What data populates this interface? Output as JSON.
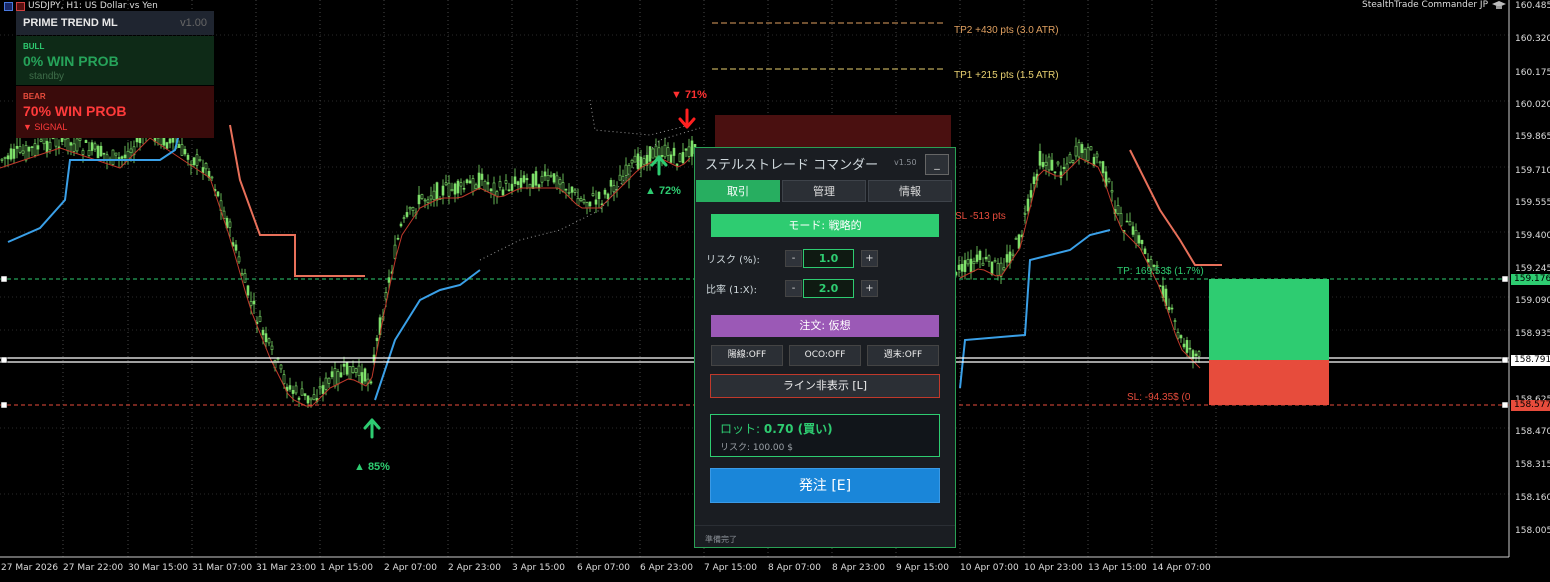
{
  "header": {
    "symbol": "USDJPY, H1:  US Dollar vs Yen",
    "ea_name": "StealthTrade Commander JP"
  },
  "prime_trend": {
    "title": "PRIME TREND  ML",
    "version": "v1.00",
    "bull_label": "BULL",
    "bull_prob": "0%  WIN PROB",
    "bull_status": "standby",
    "bear_label": "BEAR",
    "bear_prob": "70%  WIN PROB",
    "bear_status": "▼  SIGNAL"
  },
  "price_axis": {
    "labels": [
      "160.485",
      "160.320",
      "160.175",
      "160.020",
      "159.865",
      "159.710",
      "159.555",
      "159.400",
      "159.245",
      "159.090",
      "158.935",
      "158.625",
      "158.470",
      "158.315",
      "158.160",
      "158.005"
    ],
    "tags": [
      {
        "value": "159.176",
        "color": "#2ecc71"
      },
      {
        "value": "158.791",
        "color": "#ffffff"
      },
      {
        "value": "158.577",
        "color": "#e74c3c"
      }
    ]
  },
  "time_axis": [
    "27 Mar 2026",
    "27 Mar 22:00",
    "30 Mar 15:00",
    "31 Mar 07:00",
    "31 Mar 23:00",
    "1 Apr 15:00",
    "2 Apr 07:00",
    "2 Apr 23:00",
    "3 Apr 15:00",
    "6 Apr 07:00",
    "6 Apr 23:00",
    "7 Apr 15:00",
    "8 Apr 07:00",
    "8 Apr 23:00",
    "9 Apr 15:00",
    "10 Apr 07:00",
    "10 Apr 23:00",
    "13 Apr 15:00",
    "14 Apr 07:00"
  ],
  "annotations": {
    "tp2": "TP2  +430 pts  (3.0 ATR)",
    "tp1": "TP1  +215 pts  (1.5 ATR)",
    "sl_pts": "SL  -513 pts",
    "tp_money": "TP: 169.53$ (1.7%)",
    "sl_money": "SL: -94.35$ (0",
    "sig_bear": "▼ 71%",
    "sig_bull1": "▲ 72%",
    "sig_bull2": "▲ 85%"
  },
  "trade_panel": {
    "title": "ステルストレード コマンダー",
    "version": "v1.50",
    "minimize": "_",
    "tabs": [
      "取引",
      "管理",
      "情報"
    ],
    "mode": "モード: 戦略的",
    "risk_label": "リスク (%):",
    "risk_value": "1.0",
    "ratio_label": "比率 (1:X):",
    "ratio_value": "2.0",
    "minus": "-",
    "plus": "+",
    "order_type": "注文: 仮想",
    "toggles": [
      "陽線:OFF",
      "OCO:OFF",
      "週末:OFF"
    ],
    "hide_lines": "ライン非表示  [L]",
    "lot_label": "ロット: ",
    "lot_value": "0.70 (買い)",
    "lot_risk": "リスク: 100.00 $",
    "send": "発注  [E]",
    "status": "準備完了"
  },
  "colors": {
    "bull": "#2ecc71",
    "bear": "#e74c3c",
    "candle": "#7ee06a",
    "st_up": "#3aa0e8",
    "st_down": "#e8705a",
    "ma": "#c0392b"
  }
}
